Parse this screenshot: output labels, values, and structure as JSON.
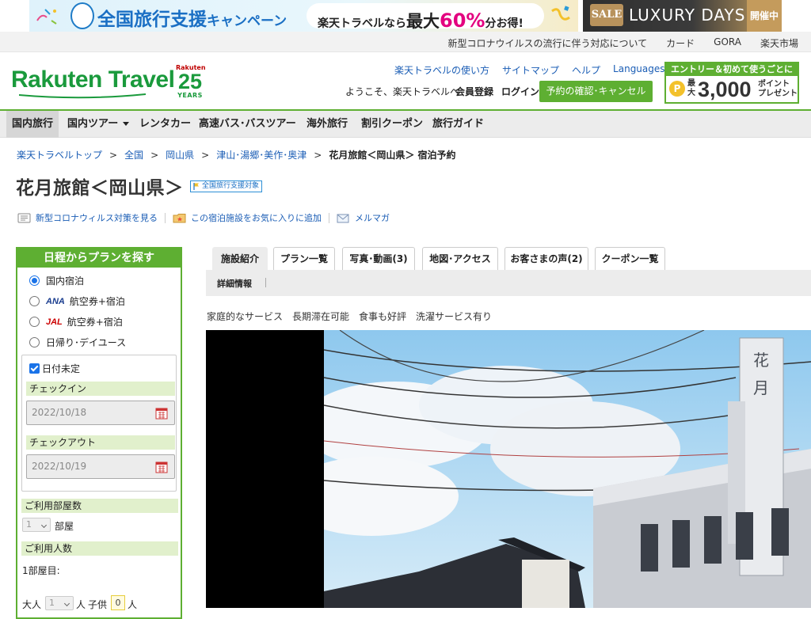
{
  "promo": {
    "campaign_title": "全国旅行支援",
    "campaign_sub": "キャンペーン",
    "pill_prefix": "楽天トラベルなら",
    "pill_max": "最大",
    "pill_pct": "60%",
    "pill_suffix": "分お得!",
    "sale_label": "SALE",
    "luxury_label": "LUXURY DAYS",
    "status_label": "開催中"
  },
  "util_links": [
    "新型コロナウイルスの流行に伴う対応について",
    "カード",
    "GORA",
    "楽天市場"
  ],
  "header": {
    "logo_text": "Rakuten Travel",
    "years_top": "Rakuten",
    "years_num": "25",
    "years_bottom": "YEARS",
    "links": [
      "楽天トラベルの使い方",
      "サイトマップ",
      "ヘルプ",
      "Languages"
    ],
    "welcome": "ようこそ、楽天トラベルへ",
    "register": "会員登録",
    "login": "ログイン",
    "confirm_button": "予約の確認･キャンセル",
    "entry_top": "エントリー＆初めて使うごとに",
    "entry_coin": "P",
    "entry_max": "最大",
    "entry_points": "3,000",
    "entry_unit": "ポイント プレゼント"
  },
  "nav": [
    "国内旅行",
    "国内ツアー",
    "レンタカー",
    "高速バス･バスツアー",
    "海外旅行",
    "割引クーポン",
    "旅行ガイド"
  ],
  "breadcrumb": {
    "items": [
      "楽天トラベルトップ",
      "全国",
      "岡山県",
      "津山･湯郷･美作･奥津"
    ],
    "current": "花月旅館＜岡山県＞ 宿泊予約",
    "separator": ">"
  },
  "title": "花月旅館＜岡山県＞",
  "support_badge": "全国旅行支援対象",
  "sub_links": {
    "covid": "新型コロナウィルス対策を見る",
    "favorite": "この宿泊施設をお気に入りに追加",
    "mail": "メルマガ"
  },
  "search": {
    "heading": "日程からプランを探す",
    "options": [
      {
        "label": "国内宿泊",
        "airline": "",
        "checked": true
      },
      {
        "label": "航空券+宿泊",
        "airline": "ANA",
        "checked": false
      },
      {
        "label": "航空券+宿泊",
        "airline": "JAL",
        "checked": false
      },
      {
        "label": "日帰り･デイユース",
        "airline": "",
        "checked": false
      }
    ],
    "date_undecided": "日付未定",
    "checkin_label": "チェックイン",
    "checkin_value": "2022/10/18",
    "checkout_label": "チェックアウト",
    "checkout_value": "2022/10/19",
    "rooms_label": "ご利用部屋数",
    "rooms_value": "1",
    "rooms_unit": "部屋",
    "people_label": "ご利用人数",
    "room1_label": "1部屋目:",
    "adult_label": "大人",
    "adult_value": "1",
    "adult_unit": "人",
    "child_label": "子供",
    "child_value": "0",
    "child_unit": "人"
  },
  "tabs": [
    "施設紹介",
    "プラン一覧",
    "写真･動画(3)",
    "地図･アクセス",
    "お客さまの声(2)",
    "クーポン一覧"
  ],
  "subtab": "詳細情報",
  "features": "家庭的なサービス　長期滞在可能　食事も好評　洗濯サービス有り",
  "photo_sign": "花月旅館",
  "colors": {
    "brand_green": "#5eaf32",
    "link_blue": "#1a5db5",
    "logo_green": "#1a9a3c"
  }
}
